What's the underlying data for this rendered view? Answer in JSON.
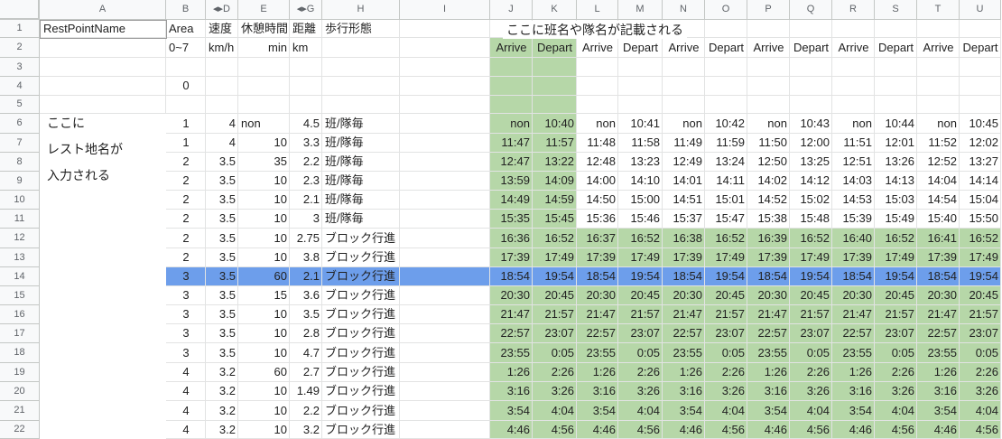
{
  "sheet": {
    "column_headers": [
      "A",
      "B",
      "◂▸D",
      "E",
      "◂▸G",
      "H",
      "I",
      "J",
      "K",
      "L",
      "M",
      "N",
      "O",
      "P",
      "Q",
      "R",
      "S",
      "T",
      "U"
    ],
    "row_numbers": [
      "1",
      "2",
      "3",
      "4",
      "5",
      "6",
      "7",
      "8",
      "9",
      "10",
      "11",
      "12",
      "13",
      "14",
      "15",
      "16",
      "17",
      "18",
      "19",
      "20",
      "21",
      "22"
    ],
    "header_row1": {
      "A": "RestPointName",
      "B": "Area",
      "D": "速度",
      "E": "休憩時間",
      "G": "距離",
      "H": "歩行形態",
      "note": "ここに班名や隊名が記載される"
    },
    "header_row2": {
      "B": "0~7",
      "D": "km/h",
      "E": "min",
      "G": "km",
      "pairs": [
        "Arrive",
        "Depart"
      ]
    },
    "row4": {
      "B": "0"
    },
    "annotation_a": [
      "ここに",
      "レスト地名が",
      "入力される"
    ],
    "rows": [
      {
        "B": "1",
        "D": "4",
        "E": "non",
        "G": "4.5",
        "H": "班/隊毎",
        "times": [
          "non",
          "10:40",
          "non",
          "10:41",
          "non",
          "10:42",
          "non",
          "10:43",
          "non",
          "10:44",
          "non",
          "10:45"
        ]
      },
      {
        "B": "1",
        "D": "4",
        "E": "10",
        "G": "3.3",
        "H": "班/隊毎",
        "times": [
          "11:47",
          "11:57",
          "11:48",
          "11:58",
          "11:49",
          "11:59",
          "11:50",
          "12:00",
          "11:51",
          "12:01",
          "11:52",
          "12:02"
        ]
      },
      {
        "B": "2",
        "D": "3.5",
        "E": "35",
        "G": "2.2",
        "H": "班/隊毎",
        "times": [
          "12:47",
          "13:22",
          "12:48",
          "13:23",
          "12:49",
          "13:24",
          "12:50",
          "13:25",
          "12:51",
          "13:26",
          "12:52",
          "13:27"
        ]
      },
      {
        "B": "2",
        "D": "3.5",
        "E": "10",
        "G": "2.3",
        "H": "班/隊毎",
        "times": [
          "13:59",
          "14:09",
          "14:00",
          "14:10",
          "14:01",
          "14:11",
          "14:02",
          "14:12",
          "14:03",
          "14:13",
          "14:04",
          "14:14"
        ]
      },
      {
        "B": "2",
        "D": "3.5",
        "E": "10",
        "G": "2.1",
        "H": "班/隊毎",
        "times": [
          "14:49",
          "14:59",
          "14:50",
          "15:00",
          "14:51",
          "15:01",
          "14:52",
          "15:02",
          "14:53",
          "15:03",
          "14:54",
          "15:04"
        ]
      },
      {
        "B": "2",
        "D": "3.5",
        "E": "10",
        "G": "3",
        "H": "班/隊毎",
        "times": [
          "15:35",
          "15:45",
          "15:36",
          "15:46",
          "15:37",
          "15:47",
          "15:38",
          "15:48",
          "15:39",
          "15:49",
          "15:40",
          "15:50"
        ]
      },
      {
        "B": "2",
        "D": "3.5",
        "E": "10",
        "G": "2.75",
        "H": "ブロック行進",
        "times": [
          "16:36",
          "16:52",
          "16:37",
          "16:52",
          "16:38",
          "16:52",
          "16:39",
          "16:52",
          "16:40",
          "16:52",
          "16:41",
          "16:52"
        ]
      },
      {
        "B": "2",
        "D": "3.5",
        "E": "10",
        "G": "3.8",
        "H": "ブロック行進",
        "times": [
          "17:39",
          "17:49",
          "17:39",
          "17:49",
          "17:39",
          "17:49",
          "17:39",
          "17:49",
          "17:39",
          "17:49",
          "17:39",
          "17:49"
        ]
      },
      {
        "B": "3",
        "D": "3.5",
        "E": "60",
        "G": "2.1",
        "H": "ブロック行進",
        "times": [
          "18:54",
          "19:54",
          "18:54",
          "19:54",
          "18:54",
          "19:54",
          "18:54",
          "19:54",
          "18:54",
          "19:54",
          "18:54",
          "19:54"
        ]
      },
      {
        "B": "3",
        "D": "3.5",
        "E": "15",
        "G": "3.6",
        "H": "ブロック行進",
        "times": [
          "20:30",
          "20:45",
          "20:30",
          "20:45",
          "20:30",
          "20:45",
          "20:30",
          "20:45",
          "20:30",
          "20:45",
          "20:30",
          "20:45"
        ]
      },
      {
        "B": "3",
        "D": "3.5",
        "E": "10",
        "G": "3.5",
        "H": "ブロック行進",
        "times": [
          "21:47",
          "21:57",
          "21:47",
          "21:57",
          "21:47",
          "21:57",
          "21:47",
          "21:57",
          "21:47",
          "21:57",
          "21:47",
          "21:57"
        ]
      },
      {
        "B": "3",
        "D": "3.5",
        "E": "10",
        "G": "2.8",
        "H": "ブロック行進",
        "times": [
          "22:57",
          "23:07",
          "22:57",
          "23:07",
          "22:57",
          "23:07",
          "22:57",
          "23:07",
          "22:57",
          "23:07",
          "22:57",
          "23:07"
        ]
      },
      {
        "B": "3",
        "D": "3.5",
        "E": "10",
        "G": "4.7",
        "H": "ブロック行進",
        "times": [
          "23:55",
          "0:05",
          "23:55",
          "0:05",
          "23:55",
          "0:05",
          "23:55",
          "0:05",
          "23:55",
          "0:05",
          "23:55",
          "0:05"
        ]
      },
      {
        "B": "4",
        "D": "3.2",
        "E": "60",
        "G": "2.7",
        "H": "ブロック行進",
        "times": [
          "1:26",
          "2:26",
          "1:26",
          "2:26",
          "1:26",
          "2:26",
          "1:26",
          "2:26",
          "1:26",
          "2:26",
          "1:26",
          "2:26"
        ]
      },
      {
        "B": "4",
        "D": "3.2",
        "E": "10",
        "G": "1.49",
        "H": "ブロック行進",
        "times": [
          "3:16",
          "3:26",
          "3:16",
          "3:26",
          "3:16",
          "3:26",
          "3:16",
          "3:26",
          "3:16",
          "3:26",
          "3:16",
          "3:26"
        ]
      },
      {
        "B": "4",
        "D": "3.2",
        "E": "10",
        "G": "2.2",
        "H": "ブロック行進",
        "times": [
          "3:54",
          "4:04",
          "3:54",
          "4:04",
          "3:54",
          "4:04",
          "3:54",
          "4:04",
          "3:54",
          "4:04",
          "3:54",
          "4:04"
        ]
      },
      {
        "B": "4",
        "D": "3.2",
        "E": "10",
        "G": "3.2",
        "H": "ブロック行進",
        "times": [
          "4:46",
          "4:56",
          "4:46",
          "4:56",
          "4:46",
          "4:56",
          "4:46",
          "4:56",
          "4:46",
          "4:56",
          "4:46",
          "4:56"
        ]
      }
    ],
    "colors": {
      "green": "#b6d7a8",
      "blue": "#6d9eeb"
    }
  }
}
